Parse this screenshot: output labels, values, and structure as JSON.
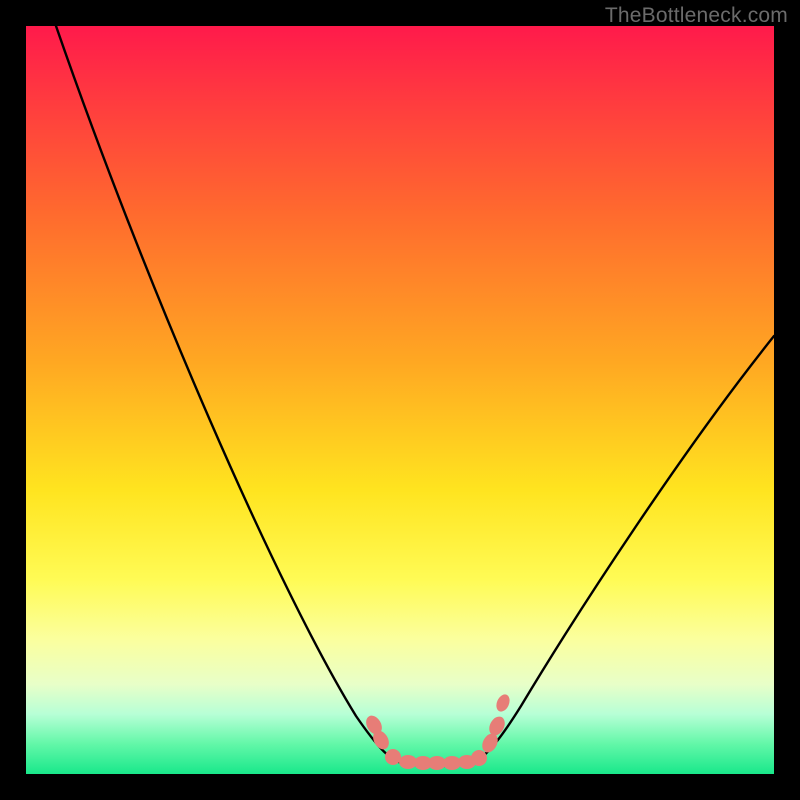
{
  "watermark": "TheBottleneck.com",
  "chart_data": {
    "type": "line",
    "title": "",
    "xlabel": "",
    "ylabel": "",
    "xlim": [
      0,
      100
    ],
    "ylim": [
      0,
      100
    ],
    "grid": false,
    "legend_position": "none",
    "note": "Black V-shaped curve over red→green vertical gradient; salmon dotted markers near the valley bottom. Values are approximate readings from pixel positions (axis ticks not shown).",
    "series": [
      {
        "name": "bottleneck-curve-left",
        "x": [
          4,
          10,
          16,
          22,
          28,
          34,
          40,
          44,
          47,
          49
        ],
        "values": [
          100,
          87,
          74,
          61,
          48,
          35,
          23,
          13,
          6,
          2
        ]
      },
      {
        "name": "bottleneck-curve-bottom",
        "x": [
          49,
          51,
          53,
          55,
          57,
          59,
          61
        ],
        "values": [
          2,
          1,
          1,
          1,
          1,
          1,
          2
        ]
      },
      {
        "name": "bottleneck-curve-right",
        "x": [
          61,
          64,
          68,
          74,
          80,
          88,
          96,
          100
        ],
        "values": [
          2,
          6,
          12,
          21,
          30,
          42,
          53,
          59
        ]
      },
      {
        "name": "valley-markers",
        "x": [
          46.5,
          47.5,
          49,
          51,
          53,
          55,
          57,
          59,
          60.5,
          62,
          63,
          63.8
        ],
        "values": [
          6.5,
          4.5,
          2.3,
          1.6,
          1.5,
          1.5,
          1.5,
          1.6,
          2.2,
          4.2,
          6.5,
          9.5
        ]
      }
    ],
    "gradient_stops": [
      {
        "pos": 0,
        "color": "#ff1a4b"
      },
      {
        "pos": 10,
        "color": "#ff3b3f"
      },
      {
        "pos": 25,
        "color": "#ff6a2e"
      },
      {
        "pos": 45,
        "color": "#ffa822"
      },
      {
        "pos": 62,
        "color": "#ffe41f"
      },
      {
        "pos": 74,
        "color": "#fffb55"
      },
      {
        "pos": 82,
        "color": "#fbff9e"
      },
      {
        "pos": 88,
        "color": "#e8ffc8"
      },
      {
        "pos": 92,
        "color": "#b7ffd6"
      },
      {
        "pos": 96,
        "color": "#62f7a8"
      },
      {
        "pos": 100,
        "color": "#19e88b"
      }
    ]
  }
}
